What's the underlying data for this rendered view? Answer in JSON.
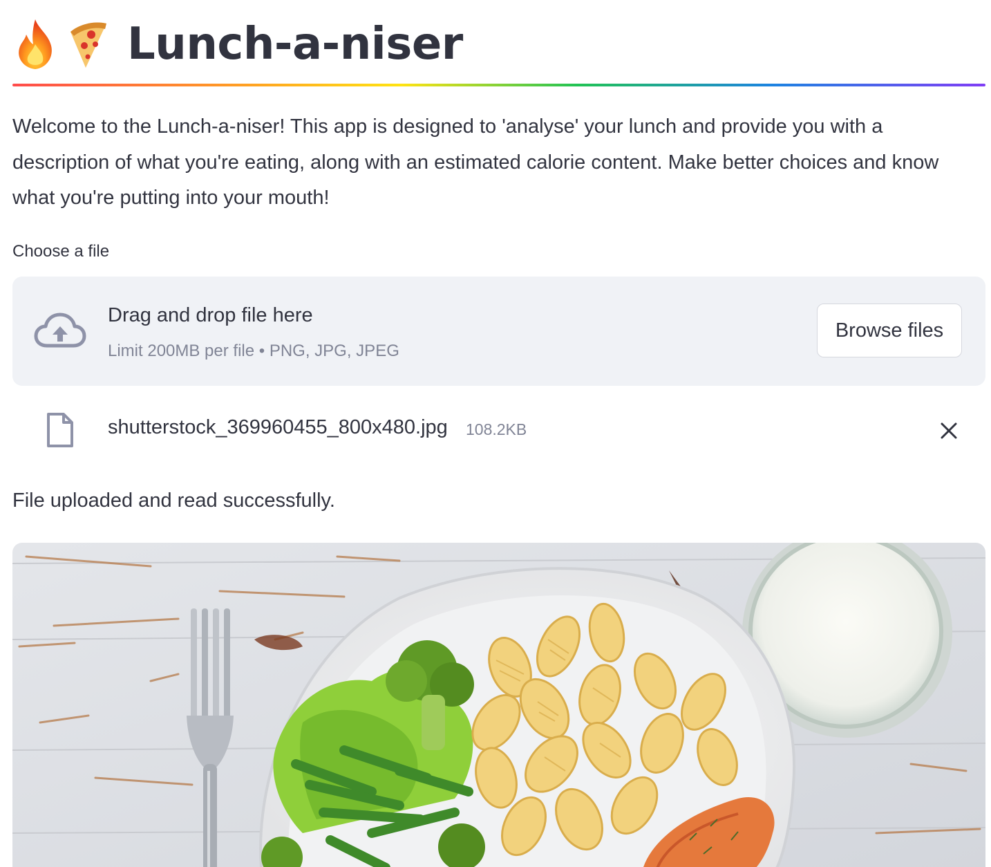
{
  "app": {
    "title": "Lunch-a-niser",
    "title_emojis": [
      "fire-emoji",
      "pizza-emoji"
    ]
  },
  "intro": {
    "text": "Welcome to the Lunch-a-niser! This app is designed to 'analyse' your lunch and provide you with a description of what you're eating, along with an estimated calorie content. Make better choices and know what you're putting into your mouth!"
  },
  "uploader": {
    "label": "Choose a file",
    "drop_text": "Drag and drop file here",
    "limit_text": "Limit 200MB per file • PNG, JPG, JPEG",
    "browse_label": "Browse files",
    "icon": "cloud-upload-icon"
  },
  "uploaded_file": {
    "name": "shutterstock_369960455_800x480.jpg",
    "size": "108.2KB",
    "icon": "file-icon",
    "remove_icon": "close-icon"
  },
  "status": {
    "message": "File uploaded and read successfully."
  },
  "colors": {
    "text": "#31333f",
    "muted": "#808495",
    "dropzone_bg": "#f0f2f6",
    "border": "#d5d7de"
  }
}
